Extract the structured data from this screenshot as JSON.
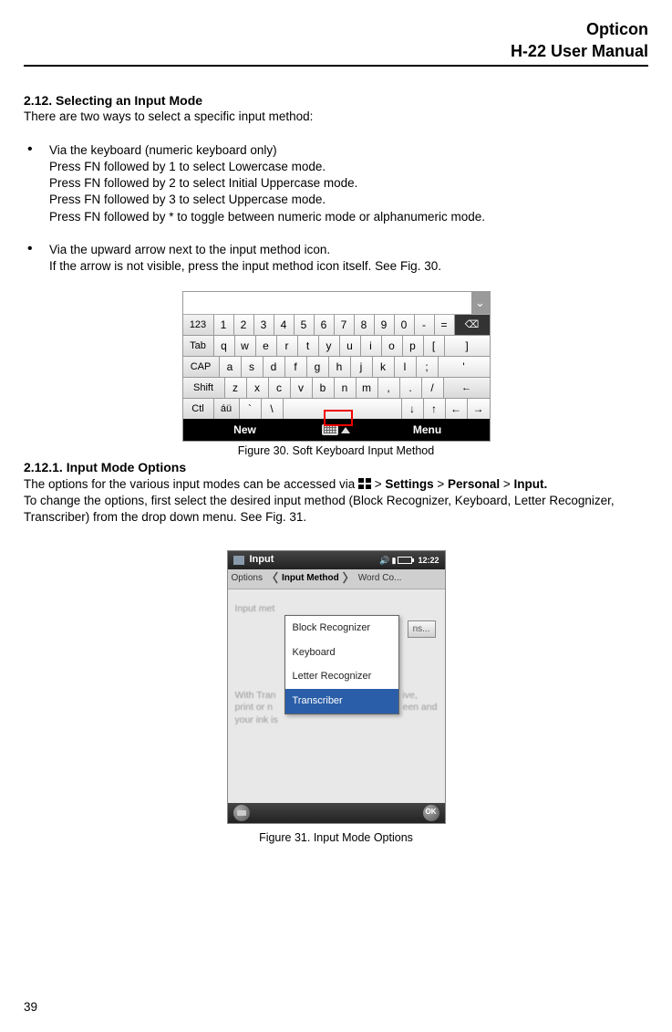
{
  "header": {
    "line1": "Opticon",
    "line2": "H-22 User Manual"
  },
  "section": {
    "num_title": "2.12. Selecting an Input Mode",
    "intro": "There are two ways to select a specific input method:"
  },
  "bullet1": {
    "l1": "Via the keyboard (numeric keyboard only)",
    "l2": "Press FN followed by 1 to select Lowercase mode.",
    "l3": "Press FN followed by 2 to select Initial Uppercase mode.",
    "l4": "Press FN followed by 3 to select Uppercase mode.",
    "l5": "Press FN followed by *  to toggle between numeric mode or alphanumeric mode."
  },
  "bullet2": {
    "l1": "Via the upward arrow next to the input method icon.",
    "l2": "If the arrow is not visible, press the input method icon itself. See Fig. 30."
  },
  "fig30": {
    "caption": "Figure 30. Soft Keyboard Input Method",
    "row1_labels": [
      "123",
      "1",
      "2",
      "3",
      "4",
      "5",
      "6",
      "7",
      "8",
      "9",
      "0",
      "-",
      "=",
      "⌫"
    ],
    "row2_labels": [
      "Tab",
      "q",
      "w",
      "e",
      "r",
      "t",
      "y",
      "u",
      "i",
      "o",
      "p",
      "[",
      "]"
    ],
    "row3_labels": [
      "CAP",
      "a",
      "s",
      "d",
      "f",
      "g",
      "h",
      "j",
      "k",
      "l",
      ";",
      "'"
    ],
    "row4_labels": [
      "Shift",
      "z",
      "x",
      "c",
      "v",
      "b",
      "n",
      "m",
      ",",
      ".",
      "/",
      "←"
    ],
    "row5_labels": [
      "Ctl",
      "áü",
      "`",
      "\\",
      " ",
      "↓",
      "↑",
      "←",
      "→"
    ],
    "bar_left": "New",
    "bar_right": "Menu"
  },
  "subsection": {
    "num_title": "2.12.1.     Input Mode Options",
    "p1a": "The options for the various input modes can be accessed via ",
    "p1b": " > ",
    "p1_settings": "Settings",
    "p1_gt": " > ",
    "p1_personal": "Personal",
    "p1_gt2": " > ",
    "p1_input": "Input.",
    "p2": "To change the options, first select the desired input method (Block Recognizer, Keyboard, Letter Recognizer, Transcriber) from the drop down menu. See Fig. 31."
  },
  "fig31": {
    "caption": "Figure 31. Input Mode Options",
    "title": "Input",
    "clock": "12:22",
    "tab_left": "Options",
    "tab_mid": "Input Method",
    "tab_right": "Word Co...",
    "faint_label": "Input met",
    "options_btn": "ns...",
    "dropdown": [
      "Block Recognizer",
      "Keyboard",
      "Letter Recognizer",
      "Transcriber"
    ],
    "para_l1": "With Tran",
    "para_l2": "print or n",
    "para_l3": "your ink is",
    "para_r1": "ive,",
    "para_r2": "een and",
    "ok": "OK"
  },
  "page_number": "39"
}
